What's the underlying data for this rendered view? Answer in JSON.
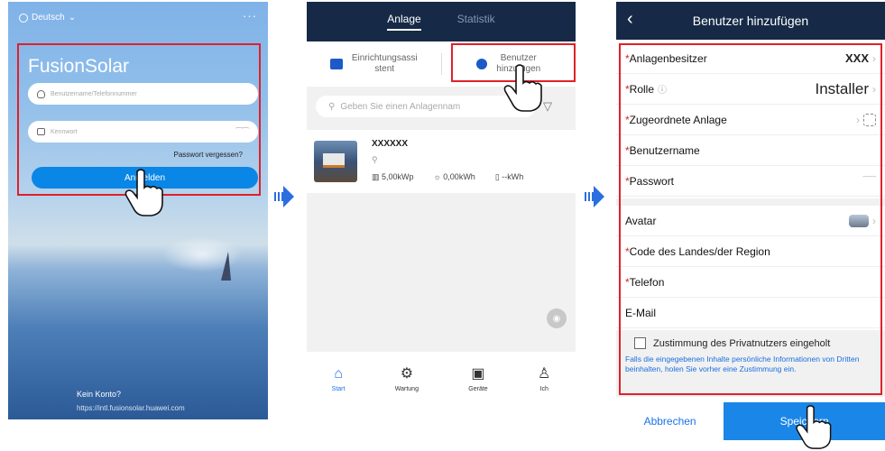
{
  "login": {
    "language": "Deutsch",
    "menu_glyph": "···",
    "app_title": "FusionSolar",
    "username_placeholder": "Benutzername/Telefonnummer",
    "password_placeholder": "Kennwort",
    "forgot_password": "Passwort vergessen?",
    "login_button": "Anmelden",
    "no_account": "Kein Konto?",
    "url": "https://intl.fusionsolar.huawei.com"
  },
  "plants": {
    "tabs": [
      {
        "label": "Anlage"
      },
      {
        "label": "Statistik"
      }
    ],
    "actions": [
      {
        "label": "Einrichtungsassistent",
        "line1": "Einrichtungsassi",
        "line2": "stent"
      },
      {
        "label": "Benutzer hinzufügen",
        "line1": "Benutzer",
        "line2": "hinzufügen"
      }
    ],
    "search_placeholder": "Geben Sie einen Anlagennam",
    "plant": {
      "name": "XXXXXX",
      "capacity": "5,00kWp",
      "energy": "0,00kWh",
      "other": "--kWh"
    },
    "nav": [
      {
        "label": "Start"
      },
      {
        "label": "Wartung"
      },
      {
        "label": "Geräte"
      },
      {
        "label": "Ich"
      }
    ]
  },
  "add_user": {
    "title": "Benutzer hinzufügen",
    "fields": [
      {
        "label": "Anlagenbesitzer",
        "value": "XXX",
        "required": "*"
      },
      {
        "label": "Rolle",
        "value": "Installer",
        "required": "*"
      },
      {
        "label": "Zugeordnete Anlage",
        "value": "",
        "required": "*"
      },
      {
        "label": "Benutzername",
        "value": "",
        "required": "*"
      },
      {
        "label": "Passwort",
        "value": "",
        "required": "*"
      },
      {
        "label": "Avatar",
        "value": "",
        "required": ""
      },
      {
        "label": "Code des Landes/der Region",
        "value": "",
        "required": "*"
      },
      {
        "label": "Telefon",
        "value": "",
        "required": "*"
      },
      {
        "label": "E-Mail",
        "value": "",
        "required": ""
      }
    ],
    "consent_label": "Zustimmung des Privatnutzers eingeholt",
    "consent_note": "Falls die eingegebenen Inhalte persönliche Informationen von Dritten beinhalten, holen Sie vorher eine Zustimmung ein.",
    "cancel": "Abbrechen",
    "save": "Speichern"
  },
  "colors": {
    "header_navy": "#162a47",
    "accent_blue": "#1a86e8",
    "highlight_red": "#e0202a"
  }
}
